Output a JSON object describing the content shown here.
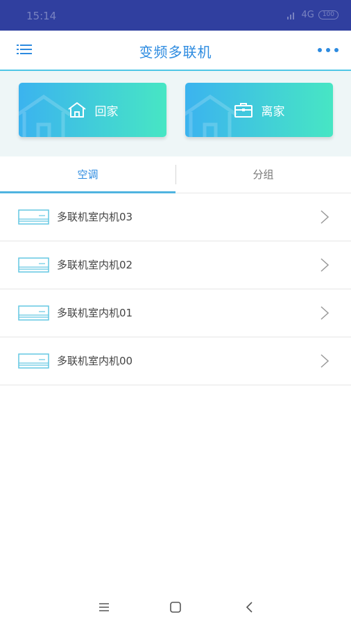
{
  "status_bar": {
    "time": "15:14",
    "network": "4G",
    "battery": "100"
  },
  "header": {
    "title": "变频多联机",
    "menu_icon": "list-menu-icon",
    "more_icon": "more-dots-icon"
  },
  "modes": {
    "home_label": "回家",
    "away_label": "离家",
    "home_icon": "house-icon",
    "away_icon": "briefcase-icon"
  },
  "tabs": [
    {
      "label": "空调",
      "active": true
    },
    {
      "label": "分组",
      "active": false
    }
  ],
  "devices": [
    {
      "label": "多联机室内机03"
    },
    {
      "label": "多联机室内机02"
    },
    {
      "label": "多联机室内机01"
    },
    {
      "label": "多联机室内机00"
    }
  ],
  "colors": {
    "accent": "#2d8be0",
    "status_bar": "#303f9f",
    "gradient_start": "#3bb3ef",
    "gradient_end": "#47e6c4",
    "panel_bg": "#eef6f7"
  }
}
